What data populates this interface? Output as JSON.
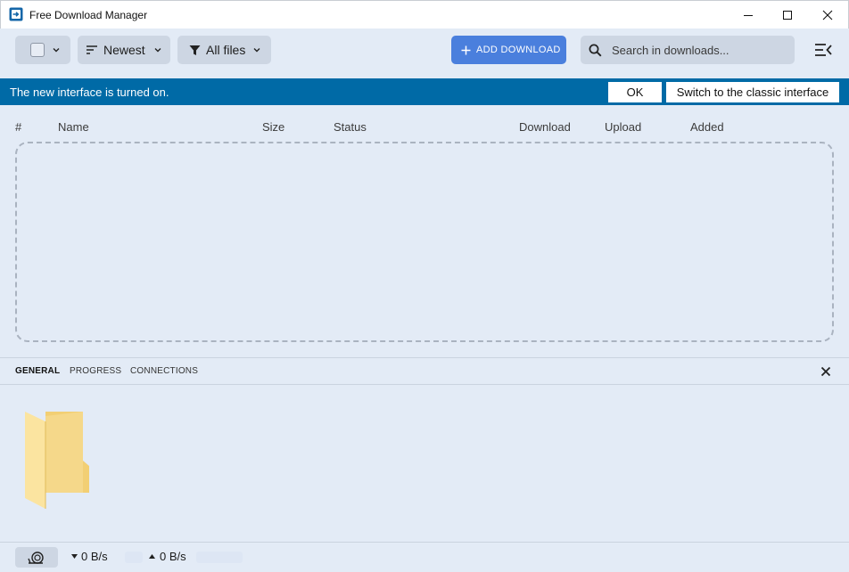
{
  "window": {
    "title": "Free Download Manager",
    "icons": {
      "app": "fdm-logo-icon",
      "minimize": "minimize-icon",
      "maximize": "maximize-icon",
      "close": "close-icon"
    }
  },
  "toolbar": {
    "sort_label": "Newest",
    "filter_label": "All files",
    "add_label": "ADD DOWNLOAD",
    "search_placeholder": "Search in downloads..."
  },
  "banner": {
    "message": "The new interface is turned on.",
    "ok_label": "OK",
    "classic_label": "Switch to the classic interface",
    "color": "#006aa6"
  },
  "table": {
    "columns": [
      "#",
      "Name",
      "Size",
      "Status",
      "Download",
      "Upload",
      "Added"
    ]
  },
  "details": {
    "tabs": [
      "GENERAL",
      "PROGRESS",
      "CONNECTIONS"
    ],
    "active_tab": "GENERAL"
  },
  "status": {
    "download_speed": "0 B/s",
    "upload_speed": "0 B/s"
  },
  "colors": {
    "accent": "#4a7fdd",
    "background": "#e3ebf6",
    "control": "#cdd6e3"
  }
}
